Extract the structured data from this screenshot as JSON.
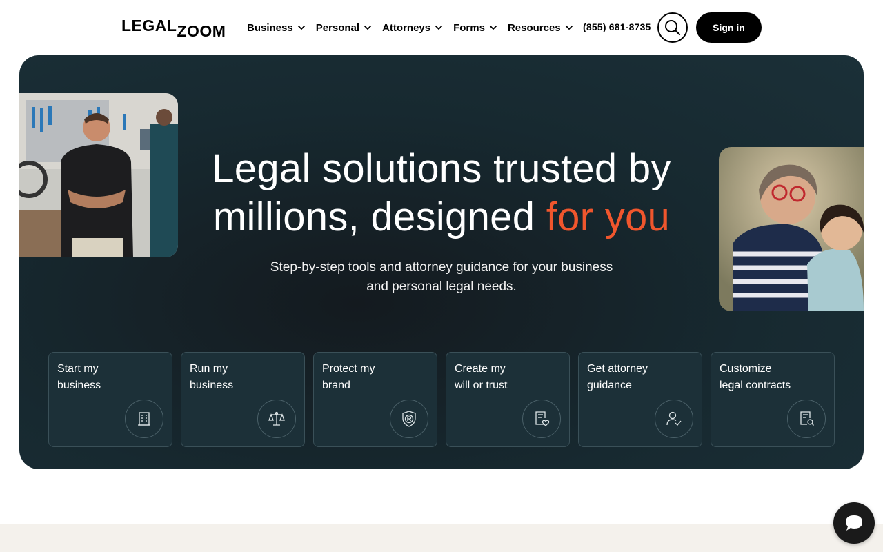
{
  "header": {
    "logo_part1": "LEGAL",
    "logo_part2": "ZOOM",
    "nav": [
      {
        "label": "Business"
      },
      {
        "label": "Personal"
      },
      {
        "label": "Attorneys"
      },
      {
        "label": "Forms"
      },
      {
        "label": "Resources"
      }
    ],
    "phone": "(855) 681-8735",
    "search_icon": "search-icon",
    "signin_label": "Sign in"
  },
  "hero": {
    "headline_line1": "Legal solutions trusted by",
    "headline_line2_start": "millions, designed ",
    "headline_accent": "for you",
    "subline": "Step-by-step tools and attorney guidance for your business and personal legal needs.",
    "accent_color": "#f0562d",
    "cards": [
      {
        "label": "Start my\nbusiness",
        "icon": "building-icon"
      },
      {
        "label": "Run my\nbusiness",
        "icon": "scales-icon"
      },
      {
        "label": "Protect my\nbrand",
        "icon": "trademark-shield-icon"
      },
      {
        "label": "Create my\nwill or trust",
        "icon": "document-heart-icon"
      },
      {
        "label": "Get attorney\nguidance",
        "icon": "user-check-icon"
      },
      {
        "label": "Customize\nlegal contracts",
        "icon": "document-search-icon"
      }
    ]
  },
  "chat": {
    "icon": "chat-bubble-icon"
  }
}
